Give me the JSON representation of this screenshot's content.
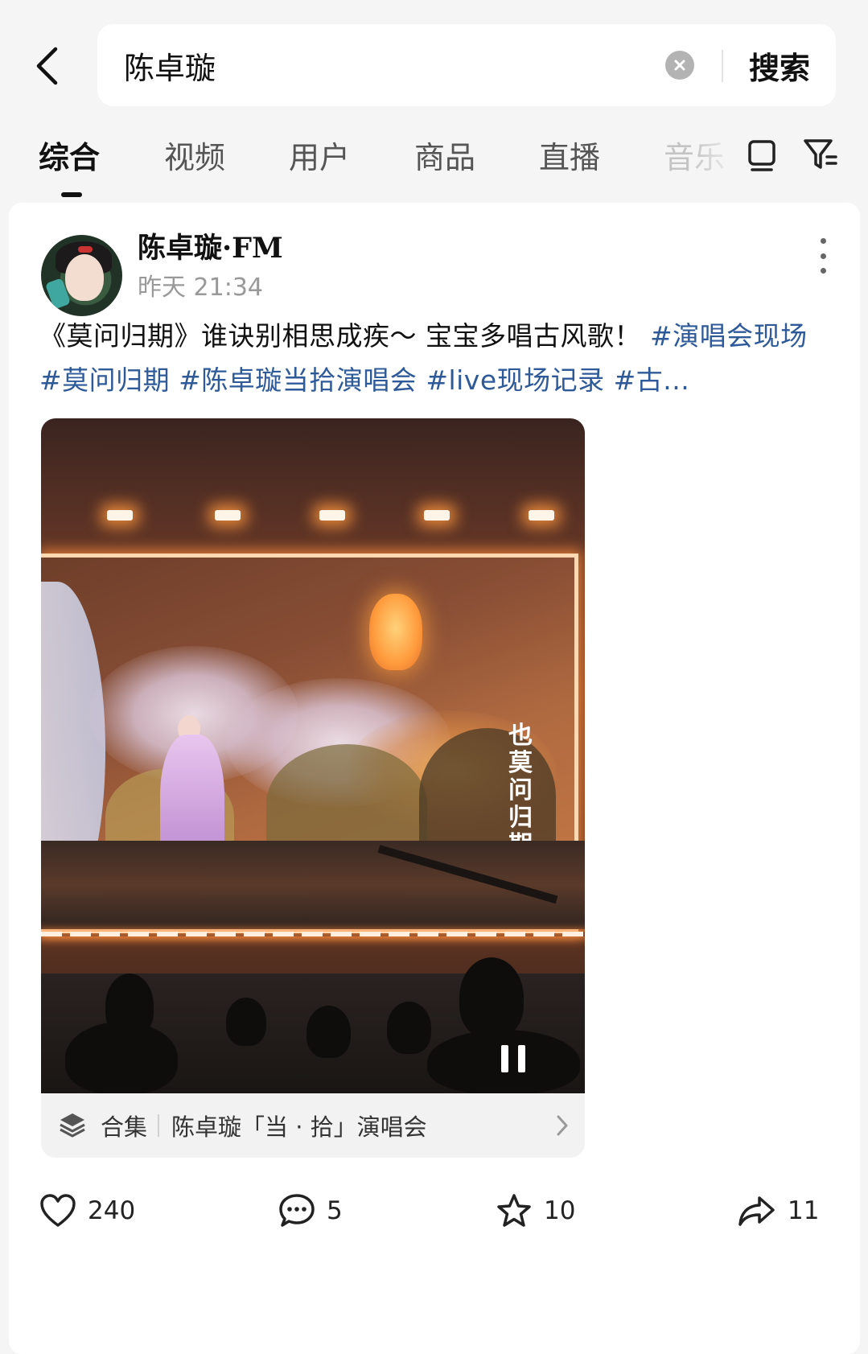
{
  "search": {
    "query": "陈卓璇",
    "button_label": "搜索"
  },
  "tabs": [
    {
      "label": "综合",
      "active": true
    },
    {
      "label": "视频",
      "active": false
    },
    {
      "label": "用户",
      "active": false
    },
    {
      "label": "商品",
      "active": false
    },
    {
      "label": "直播",
      "active": false
    },
    {
      "label": "音乐",
      "active": false
    }
  ],
  "post": {
    "username": "陈卓璇·FM",
    "time": "昨天 21:34",
    "caption_text": "《莫问归期》谁诀别相思成疾～ 宝宝多唱古风歌！ ",
    "tags": [
      "#演唱会现场",
      "#莫问归期",
      "#陈卓璇当拾演唱会",
      "#live现场记录",
      "#古..."
    ],
    "video_overlay_text": "也莫问归期",
    "collection": {
      "label": "合集",
      "title": "陈卓璇「当 · 拾」演唱会"
    }
  },
  "actions": {
    "likes": "240",
    "comments": "5",
    "favorites": "10",
    "shares": "11"
  },
  "icons": {
    "back": "chevron-left-icon",
    "clear": "clear-circle-icon",
    "layout": "layout-toggle-icon",
    "filter": "filter-icon",
    "more": "more-vertical-icon",
    "pause": "pause-icon",
    "collection": "stack-layers-icon",
    "like": "heart-icon",
    "comment": "comment-icon",
    "favorite": "star-icon",
    "share": "share-icon"
  }
}
